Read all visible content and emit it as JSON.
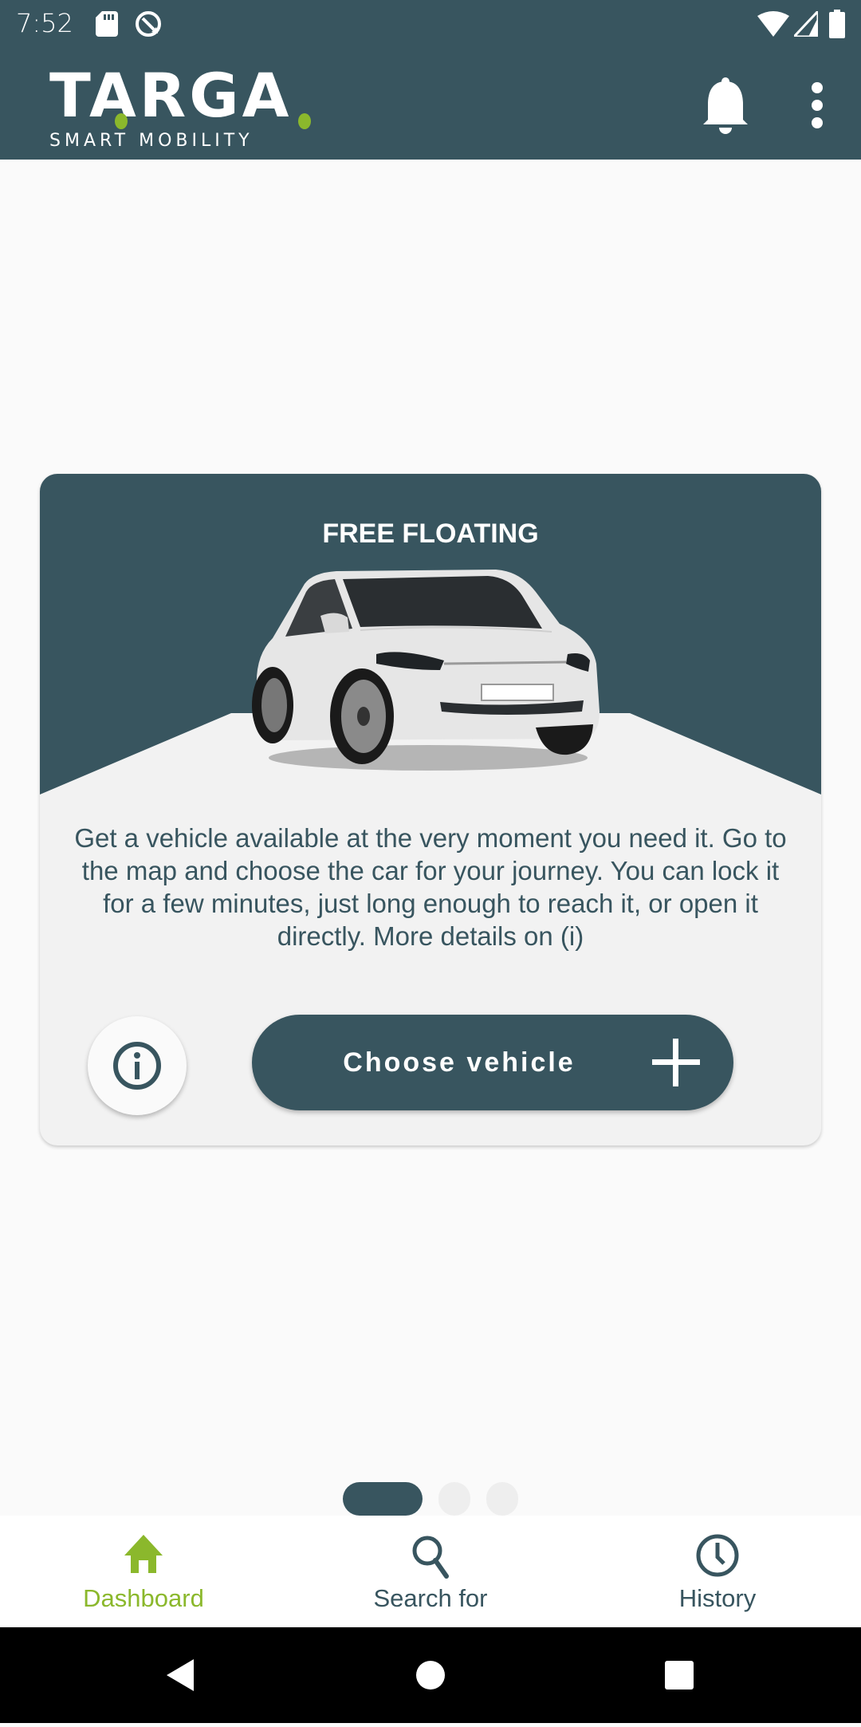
{
  "status_bar": {
    "time": "7:52",
    "left_icons": [
      "sd-card-icon",
      "sync-icon"
    ],
    "right_icons": [
      "wifi-icon",
      "signal-icon",
      "battery-icon"
    ]
  },
  "app_bar": {
    "logo_main": "TARGA",
    "logo_sub": "SMART MOBILITY",
    "actions": [
      "bell-icon",
      "more-vert-icon"
    ]
  },
  "card": {
    "title": "FREE FLOATING",
    "image": "car-illustration",
    "description": "Get a vehicle available at the very moment you need it. Go to the map and choose the car for your journey. You can lock it for a few minutes, just long enough to reach it, or open it directly. More details on (i)",
    "info_button_icon": "info-icon",
    "primary_button": {
      "label": "Choose vehicle",
      "icon": "plus-icon"
    }
  },
  "pager": {
    "total": 3,
    "active_index": 0
  },
  "bottom_nav": {
    "items": [
      {
        "label": "Dashboard",
        "icon": "home-icon",
        "active": true
      },
      {
        "label": "Search for",
        "icon": "search-icon",
        "active": false
      },
      {
        "label": "History",
        "icon": "history-icon",
        "active": false
      }
    ]
  },
  "colors": {
    "primary": "#38555f",
    "accent": "#8bb82c",
    "background": "#fafafa",
    "card_background": "#f2f2f2",
    "inactive_dot": "#eeeeee"
  }
}
